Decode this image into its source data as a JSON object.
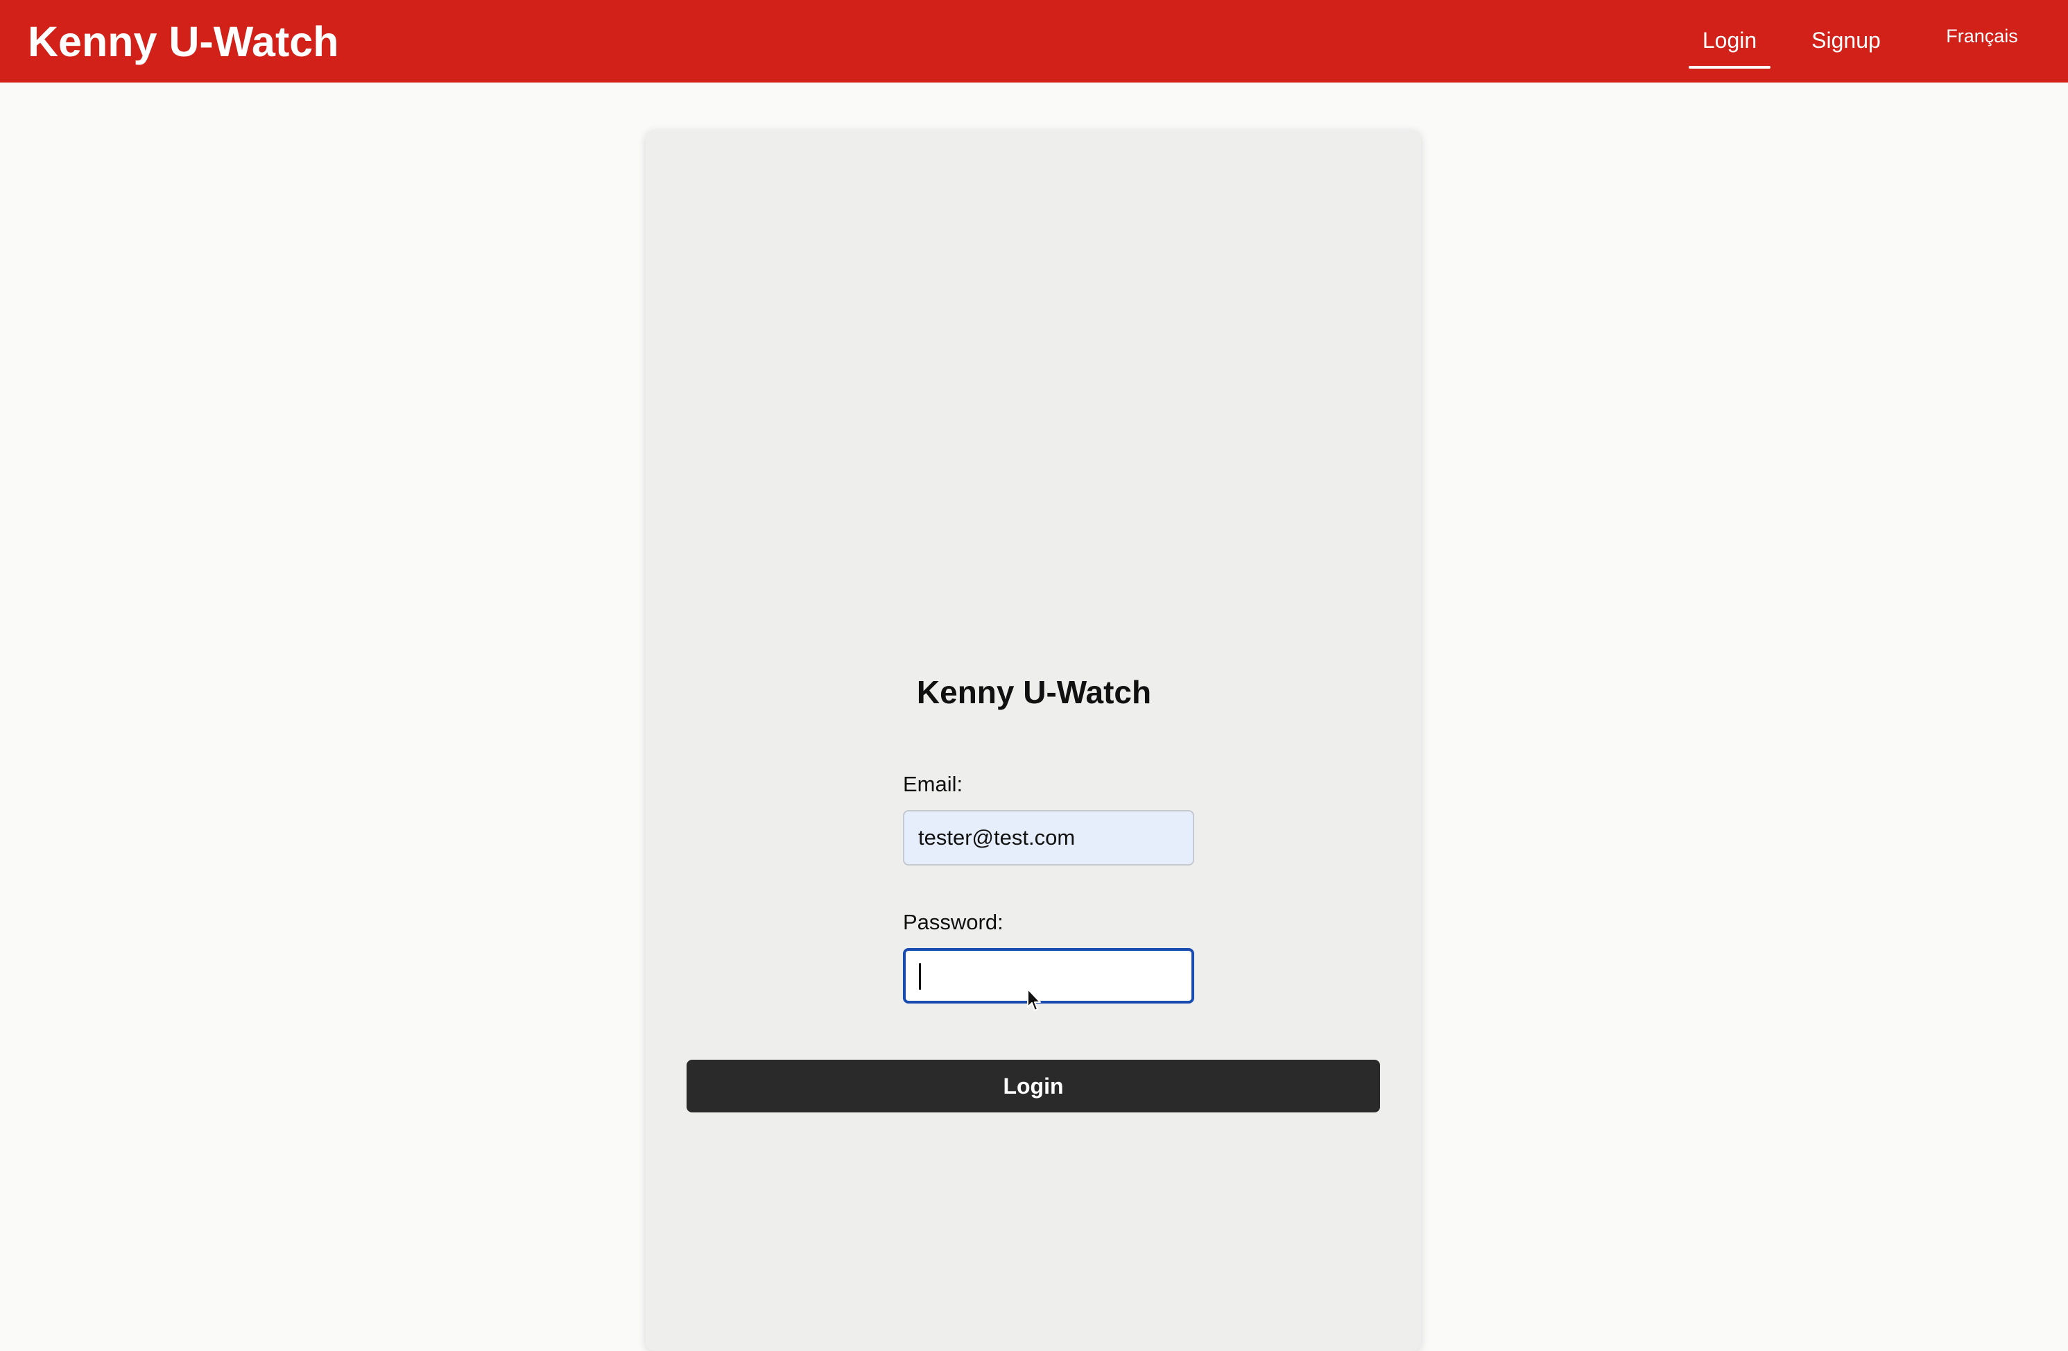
{
  "colors": {
    "brand": "#d22118",
    "button": "#2a2a2a",
    "focus_ring": "#1a4bb0",
    "autofill_bg": "#e6eefb"
  },
  "header": {
    "title": "Kenny U-Watch",
    "nav": {
      "login": "Login",
      "signup": "Signup",
      "language": "Français"
    },
    "active_tab": "login"
  },
  "login_form": {
    "title": "Kenny U-Watch",
    "email_label": "Email:",
    "email_value": "tester@test.com",
    "password_label": "Password:",
    "password_value": "",
    "submit_label": "Login"
  },
  "icons": {
    "pointer": "mouse-pointer-icon"
  }
}
